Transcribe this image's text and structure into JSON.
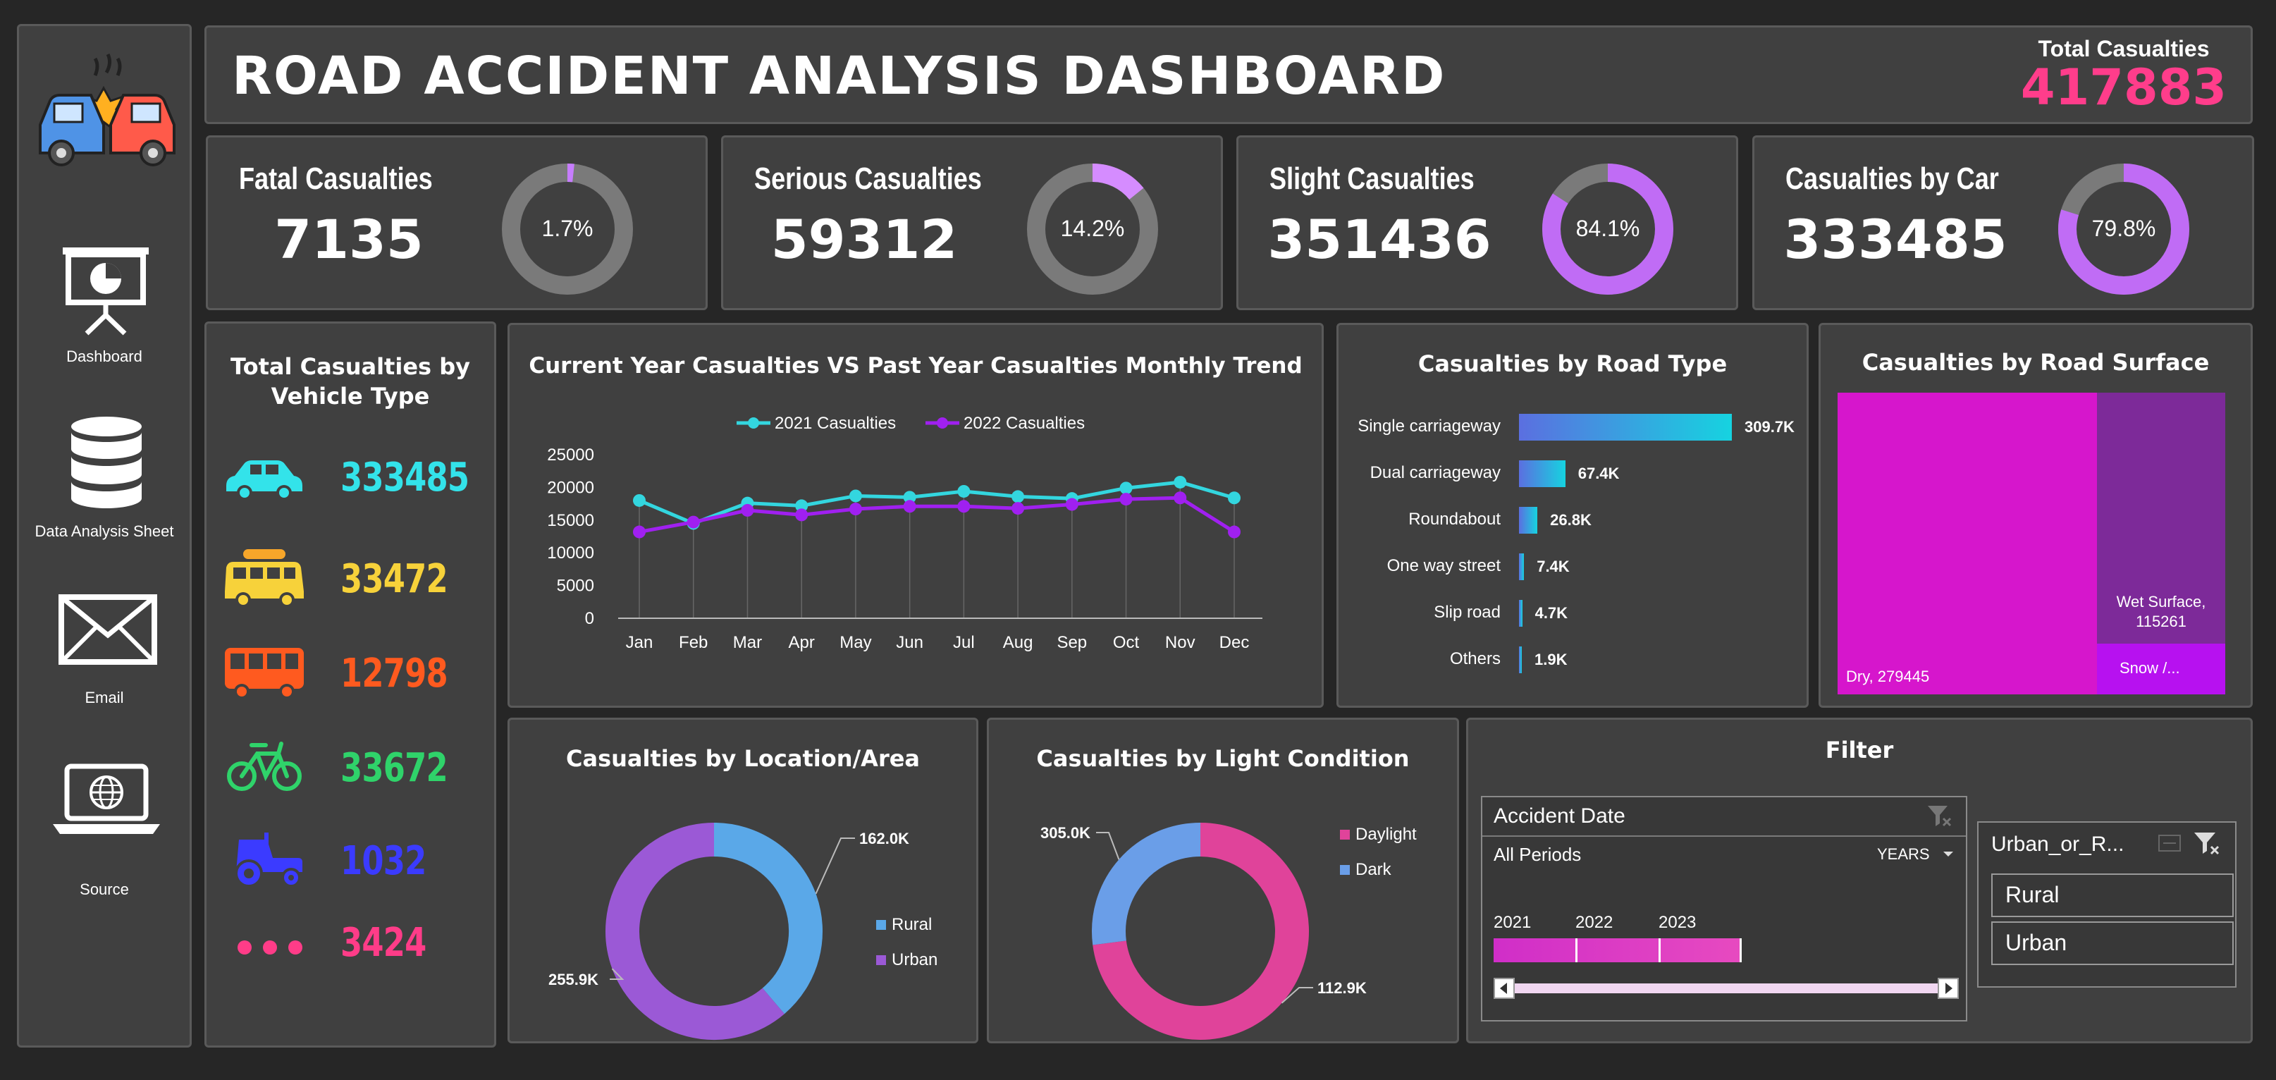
{
  "header": {
    "title": "ROAD ACCIDENT ANALYSIS DASHBOARD",
    "total_label": "Total Casualties",
    "total_value": "417883"
  },
  "nav": [
    {
      "label": "Dashboard",
      "icon": "presentation-chart-icon"
    },
    {
      "label": "Data Analysis Sheet",
      "icon": "database-icon"
    },
    {
      "label": "Email",
      "icon": "envelope-icon"
    },
    {
      "label": "Source",
      "icon": "laptop-globe-icon"
    }
  ],
  "kpis": [
    {
      "label": "Fatal Casualties",
      "value": "7135",
      "pct_label": "1.7%",
      "pct": 0.017
    },
    {
      "label": "Serious Casualties",
      "value": "59312",
      "pct_label": "14.2%",
      "pct": 0.142
    },
    {
      "label": "Slight Casualties",
      "value": "351436",
      "pct_label": "84.1%",
      "pct": 0.841
    },
    {
      "label": "Casualties by Car",
      "value": "333485",
      "pct_label": "79.8%",
      "pct": 0.798
    }
  ],
  "vehicle": {
    "title_line1": "Total Casualties by",
    "title_line2": "Vehicle Type",
    "items": [
      {
        "icon": "car-icon",
        "value": "333485",
        "color": "#33e3ea"
      },
      {
        "icon": "van-icon",
        "value": "33472",
        "color": "#f7d23a"
      },
      {
        "icon": "bus-icon",
        "value": "12798",
        "color": "#ff5a1f"
      },
      {
        "icon": "bicycle-icon",
        "value": "33672",
        "color": "#2fd36a"
      },
      {
        "icon": "tractor-icon",
        "value": "1032",
        "color": "#3b3bff"
      },
      {
        "icon": "more-dots-icon",
        "value": "3424",
        "color": "#ff3c88"
      }
    ]
  },
  "trend": {
    "title": "Current Year Casualties VS Past Year Casualties Monthly Trend",
    "legend": [
      "2021 Casualties",
      "2022 Casualties"
    ],
    "y_ticks": [
      "25000",
      "20000",
      "15000",
      "10000",
      "5000",
      "0"
    ]
  },
  "road_type": {
    "title": "Casualties by Road Type"
  },
  "road_surface": {
    "title": "Casualties by Road Surface",
    "labels": {
      "dry": "Dry, 279445",
      "wet_line1": "Wet Surface,",
      "wet_line2": "115261",
      "snow": "Snow /..."
    }
  },
  "location": {
    "title": "Casualties by Location/Area",
    "legend": [
      "Rural",
      "Urban"
    ],
    "labels": [
      "162.0K",
      "255.9K"
    ]
  },
  "light": {
    "title": "Casualties by Light Condition",
    "legend": [
      "Daylight",
      "Dark"
    ],
    "labels": [
      "112.9K",
      "305.0K"
    ]
  },
  "filter": {
    "title": "Filter",
    "date_slicer": {
      "title": "Accident Date",
      "period": "All Periods",
      "level": "YEARS",
      "years": [
        "2021",
        "2022",
        "2023"
      ]
    },
    "area_slicer": {
      "title": "Urban_or_R...",
      "options": [
        "Rural",
        "Urban"
      ]
    }
  },
  "chart_data": [
    {
      "type": "line",
      "title": "Current Year Casualties VS Past Year Casualties Monthly Trend",
      "categories": [
        "Jan",
        "Feb",
        "Mar",
        "Apr",
        "May",
        "Jun",
        "Jul",
        "Aug",
        "Sep",
        "Oct",
        "Nov",
        "Dec"
      ],
      "series": [
        {
          "name": "2021 Casualties",
          "color": "#33d6df",
          "values": [
            18000,
            14500,
            17600,
            17200,
            18700,
            18500,
            19400,
            18600,
            18300,
            19900,
            20800,
            18400
          ]
        },
        {
          "name": "2022 Casualties",
          "color": "#a020f0",
          "values": [
            13200,
            14700,
            16500,
            15800,
            16700,
            17100,
            17100,
            16800,
            17400,
            18200,
            18400,
            13200
          ]
        }
      ],
      "ylim": [
        0,
        25000
      ],
      "grid": false,
      "legend": "top"
    },
    {
      "type": "bar",
      "orientation": "horizontal",
      "title": "Casualties by Road Type",
      "categories": [
        "Single carriageway",
        "Dual carriageway",
        "Roundabout",
        "One way street",
        "Slip road",
        "Others"
      ],
      "values": [
        309.7,
        67.4,
        26.8,
        7.4,
        4.7,
        1.9
      ],
      "labels": [
        "309.7K",
        "67.4K",
        "26.8K",
        "7.4K",
        "4.7K",
        "1.9K"
      ],
      "unit": "K"
    },
    {
      "type": "treemap",
      "title": "Casualties by Road Surface",
      "categories": [
        "Dry",
        "Wet Surface",
        "Snow /..."
      ],
      "values": [
        279445,
        115261,
        23177
      ]
    },
    {
      "type": "pie",
      "variant": "donut",
      "title": "Casualties by Location/Area",
      "categories": [
        "Rural",
        "Urban"
      ],
      "values": [
        162.0,
        255.9
      ],
      "unit": "K",
      "colors": [
        "#5aa8e8",
        "#9b59d6"
      ],
      "legend": "right"
    },
    {
      "type": "pie",
      "variant": "donut",
      "title": "Casualties by Light Condition",
      "categories": [
        "Daylight",
        "Dark"
      ],
      "values": [
        305.0,
        112.9
      ],
      "unit": "K",
      "colors": [
        "#e0439a",
        "#6a9ee8"
      ],
      "legend": "right"
    }
  ]
}
